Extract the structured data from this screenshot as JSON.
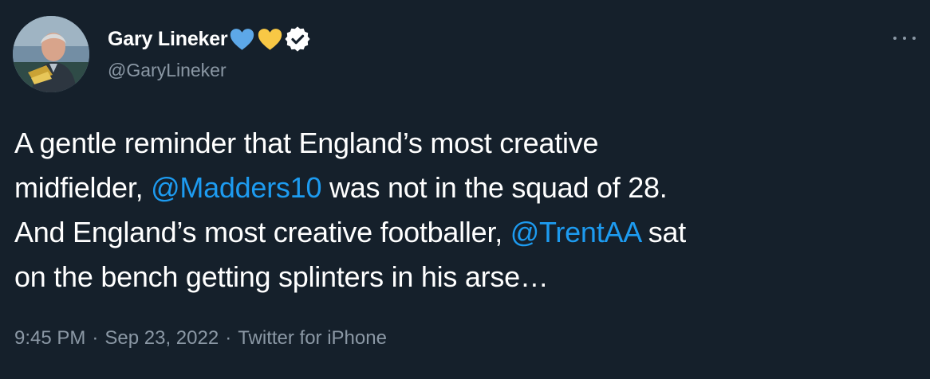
{
  "author": {
    "display_name": "Gary Lineker",
    "handle": "@GaryLineker",
    "emoji_badges": [
      "blue-heart-icon",
      "yellow-heart-icon"
    ],
    "verified": true
  },
  "tweet": {
    "lines": [
      {
        "pre": "A gentle reminder that England’s most creative",
        "mention": "",
        "post": ""
      },
      {
        "pre": "midfielder, ",
        "mention": "@Madders10",
        "post": " was not in the squad of 28."
      },
      {
        "pre": "And England’s most creative footballer, ",
        "mention": "@TrentAA",
        "post": " sat"
      },
      {
        "pre": "on the bench getting splinters in his arse…",
        "mention": "",
        "post": ""
      }
    ]
  },
  "meta": {
    "time": "9:45 PM",
    "date": "Sep 23, 2022",
    "separator": "·",
    "source": "Twitter for iPhone"
  },
  "colors": {
    "background": "#15202b",
    "text": "#ffffff",
    "secondary_text": "#8b98a5",
    "mention": "#1d9bf0",
    "blue_heart": "#5da8e8",
    "yellow_heart": "#f8c845"
  }
}
